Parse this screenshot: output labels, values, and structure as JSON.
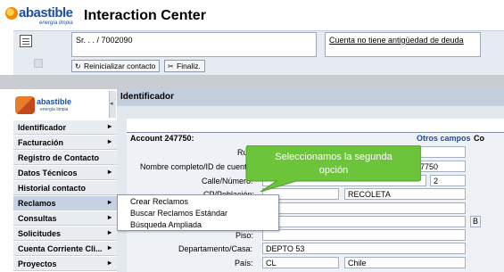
{
  "app": {
    "brand": "abastible",
    "brand_tagline": "energía limpia",
    "title": "Interaction Center"
  },
  "toolbar": {
    "contact_text": "Sr. . . / 7002090",
    "alert_text": "Cuenta no tiene antigüedad de deuda",
    "reset_label": "Reinicializar contacto",
    "finish_label": "Finaliz."
  },
  "sidebar": {
    "logo_text": "abastible",
    "logo_tagline": "energía limpia",
    "items": [
      {
        "label": "Identificador",
        "has_arrow": true
      },
      {
        "label": "Facturación",
        "has_arrow": true
      },
      {
        "label": "Registro de Contacto",
        "has_arrow": false
      },
      {
        "label": "Datos Técnicos",
        "has_arrow": true
      },
      {
        "label": "Historial contacto",
        "has_arrow": false
      },
      {
        "label": "Reclamos",
        "has_arrow": true
      },
      {
        "label": "Consultas",
        "has_arrow": true
      },
      {
        "label": "Solicitudes",
        "has_arrow": true
      },
      {
        "label": "Cuenta Corriente Cli...",
        "has_arrow": true
      },
      {
        "label": "Proyectos",
        "has_arrow": true
      }
    ],
    "arrow_glyph": "▸"
  },
  "main": {
    "title": "Identificador",
    "account_label": "Account 247750:",
    "other_fields_link": "Otros campos",
    "other_fields_extra": "Co",
    "fields": {
      "rut_label": "Ru",
      "fullname_label": "Nombre completo/ID de cuent",
      "fullname_value": "7750",
      "street_label": "Calle/Número:",
      "street_number": "2",
      "cp_label": "CP/Población:",
      "city_value": "RECOLETA",
      "floor_label": "Piso:",
      "dept_label": "Departamento/Casa:",
      "dept_value": "DEPTO 53",
      "country_label": "País:",
      "country_code": "CL",
      "country_name": "Chile",
      "side_button": "B"
    }
  },
  "dropdown": {
    "items": [
      "Crear Reclamos",
      "Buscar Reclamos Estándar",
      "Búsqueda Ampliada"
    ]
  },
  "callout": {
    "text_line1": "Seleccionamos la segunda",
    "text_line2": "opción",
    "color": "#6cc43a"
  }
}
